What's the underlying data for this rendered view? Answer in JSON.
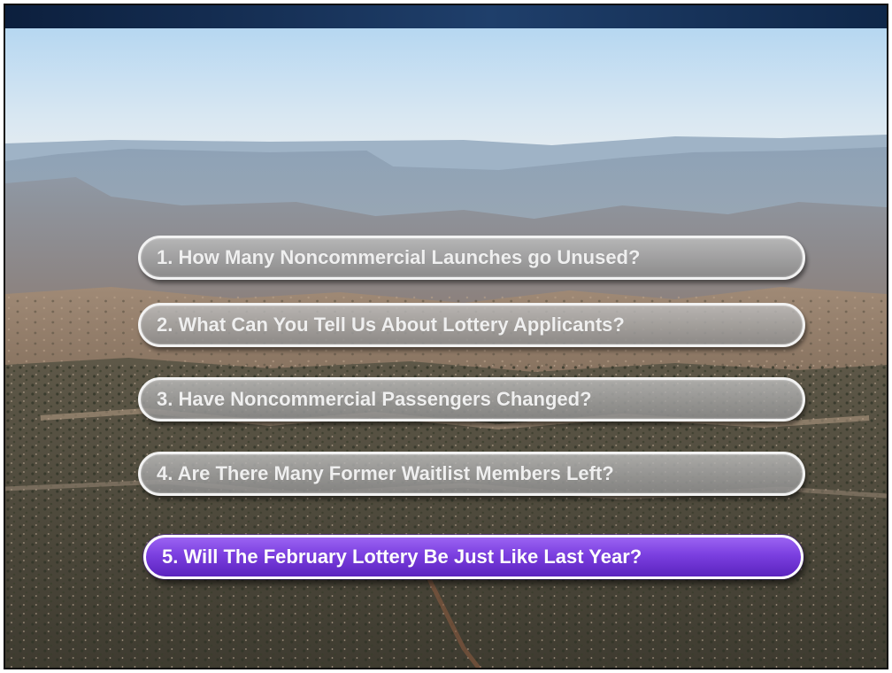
{
  "menu": {
    "items": [
      {
        "label": "1. How Many Noncommercial Launches go Unused?"
      },
      {
        "label": "2. What Can You Tell Us About Lottery Applicants?"
      },
      {
        "label": "3. Have Noncommercial Passengers Changed?"
      },
      {
        "label": "4. Are There Many Former Waitlist Members Left?"
      },
      {
        "label": "5. Will The February Lottery Be Just Like Last Year?",
        "selected": true
      }
    ],
    "selected_color": "#7b3fe0",
    "unselected_color": "#a8a8a8"
  },
  "header": {
    "bar_color": "#1f3f6b"
  }
}
